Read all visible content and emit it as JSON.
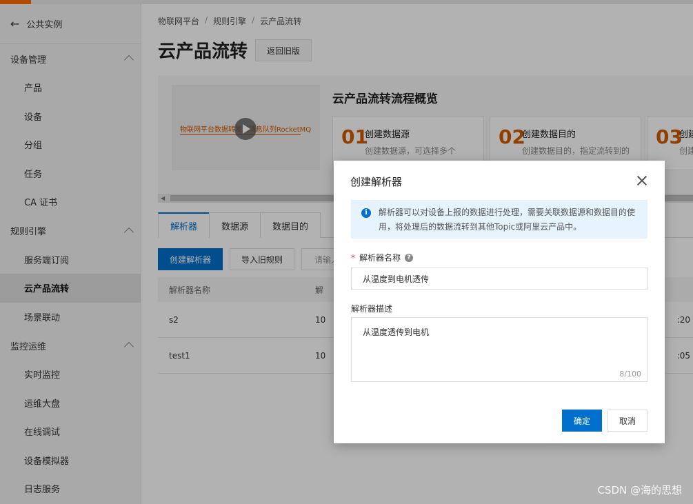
{
  "sidebar": {
    "back_label": "公共实例",
    "groups": [
      {
        "label": "设备管理",
        "items": [
          "产品",
          "设备",
          "分组",
          "任务",
          "CA 证书"
        ]
      },
      {
        "label": "规则引擎",
        "items": [
          "服务端订阅",
          "云产品流转",
          "场景联动"
        ]
      },
      {
        "label": "监控运维",
        "items": [
          "实时监控",
          "运维大盘",
          "在线调试",
          "设备模拟器",
          "日志服务"
        ]
      }
    ],
    "active_item": "云产品流转"
  },
  "breadcrumb": [
    "物联网平台",
    "规则引擎",
    "云产品流转"
  ],
  "page": {
    "title": "云产品流转",
    "back_old_label": "返回旧版"
  },
  "overview": {
    "video_caption": "物联网平台数据转发到消息队列RocketMQ",
    "title": "云产品流转流程概览",
    "steps": [
      {
        "num": "01",
        "title": "创建数据源",
        "desc": "创建数据源，可选择多个"
      },
      {
        "num": "02",
        "title": "创建数据目的",
        "desc": "创建数据目的，指定流转到的"
      },
      {
        "num": "03",
        "title": "创建",
        "desc": "创建"
      }
    ]
  },
  "tabs": [
    "解析器",
    "数据源",
    "数据目的"
  ],
  "toolbar": {
    "create_label": "创建解析器",
    "import_label": "导入旧规则",
    "search_placeholder": "请输入"
  },
  "table": {
    "headers": [
      "解析器名称",
      "解"
    ],
    "rows": [
      {
        "name": "s2",
        "col2": "10",
        "col3": ":20"
      },
      {
        "name": "test1",
        "col2": "10",
        "col3": ":05"
      }
    ]
  },
  "dialog": {
    "title": "创建解析器",
    "notice": "解析器可以对设备上报的数据进行处理，需要关联数据源和数据目的使用，将处理后的数据流转到其他Topic或阿里云产品中。",
    "name_label": "解析器名称",
    "name_value": "从温度到电机透传",
    "desc_label": "解析器描述",
    "desc_value": "从温度透传到电机",
    "desc_counter": "8/100",
    "ok_label": "确定",
    "cancel_label": "取消"
  },
  "watermark": "CSDN @海的思想"
}
